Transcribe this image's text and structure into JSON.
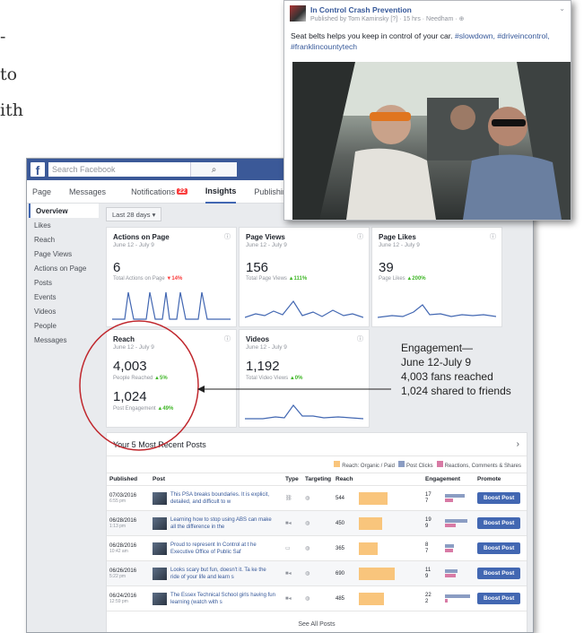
{
  "fragments": [
    "-",
    "to",
    "ith"
  ],
  "facebook": {
    "search_placeholder": "Search Facebook",
    "tabs": [
      {
        "label": "Page"
      },
      {
        "label": "Messages"
      },
      {
        "label": "Notifications",
        "badge": "22"
      },
      {
        "label": "Insights",
        "active": true
      },
      {
        "label": "Publishing Tools"
      }
    ],
    "sidebar": [
      "Overview",
      "Likes",
      "Reach",
      "Page Views",
      "Actions on Page",
      "Posts",
      "Events",
      "Videos",
      "People",
      "Messages"
    ],
    "date_range": "Last 28 days ▾",
    "cards": {
      "actions": {
        "title": "Actions on Page",
        "date": "June 12 - July 9",
        "value": "6",
        "label": "Total Actions on Page",
        "change": "▼14%",
        "trend": "down"
      },
      "views": {
        "title": "Page Views",
        "date": "June 12 - July 9",
        "value": "156",
        "label": "Total Page Views",
        "change": "▲111%",
        "trend": "up"
      },
      "likes": {
        "title": "Page Likes",
        "date": "June 12 - July 9",
        "value": "39",
        "label": "Page Likes",
        "change": "▲200%",
        "trend": "up"
      },
      "reach": {
        "title": "Reach",
        "date": "June 12 - July 9",
        "value": "4,003",
        "label": "People Reached",
        "change": "▲5%",
        "value2": "1,024",
        "label2": "Post Engagement",
        "change2": "▲49%"
      },
      "videos": {
        "title": "Videos",
        "date": "June 12 - July 9",
        "value": "1,192",
        "label": "Total Video Views",
        "change": "▲0%"
      }
    },
    "recent_posts": {
      "title": "Your 5 Most Recent Posts",
      "legend": [
        {
          "label": "Reach: Organic / Paid",
          "color": "#f9c57c"
        },
        {
          "label": "Post Clicks",
          "color": "#8b9dc3"
        },
        {
          "label": "Reactions, Comments & Shares",
          "color": "#d87aa5"
        }
      ],
      "columns": [
        "Published",
        "Post",
        "Type",
        "Targeting",
        "Reach",
        "Engagement",
        "Promote"
      ],
      "rows": [
        {
          "date": "07/03/2016",
          "time": "6:55 pm",
          "text": "This PSA breaks boundaries. It is explicit, detailed, and difficult to w",
          "reach": "544",
          "reach_frac": 0.79,
          "eng1": "17",
          "eng2": "7",
          "type_icon": "link-icon"
        },
        {
          "date": "06/28/2016",
          "time": "1:13 pm",
          "text": "Learning how to stop using ABS can make all the difference in the",
          "reach": "450",
          "reach_frac": 0.65,
          "eng1": "19",
          "eng2": "9",
          "type_icon": "video-icon"
        },
        {
          "date": "06/28/2016",
          "time": "10:42 am",
          "text": "Proud to represent In Control at t he Executive Office of Public Saf",
          "reach": "365",
          "reach_frac": 0.53,
          "eng1": "8",
          "eng2": "7",
          "type_icon": "photo-icon"
        },
        {
          "date": "06/26/2016",
          "time": "5:22 pm",
          "text": "Looks scary but fun, doesn't it. Ta ke the ride of your life and learn s",
          "reach": "690",
          "reach_frac": 1.0,
          "eng1": "11",
          "eng2": "9",
          "type_icon": "video-icon"
        },
        {
          "date": "06/24/2016",
          "time": "12:59 pm",
          "text": "The Essex Technical School girls having fun learning (watch with s",
          "reach": "485",
          "reach_frac": 0.7,
          "eng1": "22",
          "eng2": "2",
          "type_icon": "video-icon"
        }
      ],
      "promote_label": "Boost Post",
      "see_all": "See All Posts"
    }
  },
  "post_preview": {
    "page_name": "In Control Crash Prevention",
    "meta": "Published by Tom Kaminsky [?] · 15 hrs · Needham · ⊕",
    "text": "Seat belts helps you keep in control of your car. ",
    "hashtags": "#slowdown, #driveincontrol, #franklincountytech"
  },
  "annotation": [
    "Engagement—",
    "June 12-July 9",
    "4,003 fans reached",
    "1,024 shared to friends"
  ]
}
